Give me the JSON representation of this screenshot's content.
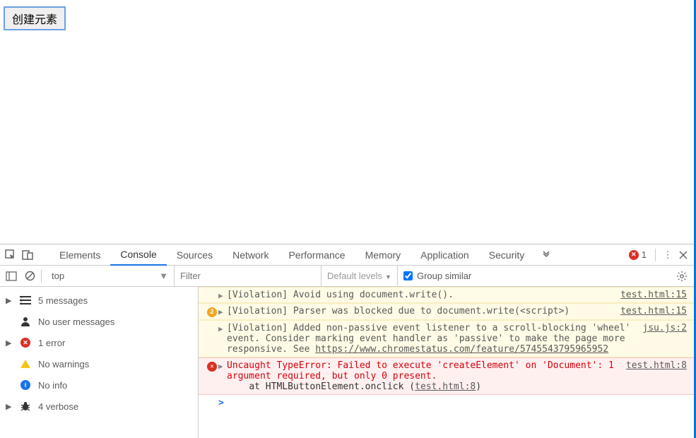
{
  "page": {
    "create_button": "创建元素"
  },
  "tabs": {
    "elements": "Elements",
    "console": "Console",
    "sources": "Sources",
    "network": "Network",
    "performance": "Performance",
    "memory": "Memory",
    "application": "Application",
    "security": "Security"
  },
  "status": {
    "error_count": "1"
  },
  "toolbar": {
    "context": "top",
    "filter_placeholder": "Filter",
    "levels": "Default levels",
    "group_similar": "Group similar"
  },
  "sidebar": {
    "messages": "5 messages",
    "user_messages": "No user messages",
    "errors": "1 error",
    "warnings": "No warnings",
    "info": "No info",
    "verbose": "4 verbose"
  },
  "messages": [
    {
      "kind": "viol",
      "text": "[Violation] Avoid using document.write().",
      "src": "test.html:15"
    },
    {
      "kind": "viol",
      "badge": "2",
      "text": "[Violation] Parser was blocked due to document.write(<script>)",
      "src": "test.html:15"
    },
    {
      "kind": "viol",
      "text": "[Violation] Added non-passive event listener to a scroll-blocking 'wheel' event. Consider marking event handler as 'passive' to make the page more responsive. See ",
      "link": "https://www.chromestatus.com/feature/5745543795965952",
      "src": "jsu.js:2"
    },
    {
      "kind": "err",
      "text": "Uncaught TypeError: Failed to execute 'createElement' on 'Document': 1 argument required, but only 0 present.",
      "stack_prefix": "    at HTMLButtonElement.onclick (",
      "stack_link": "test.html:8",
      "stack_suffix": ")",
      "src": "test.html:8"
    }
  ]
}
